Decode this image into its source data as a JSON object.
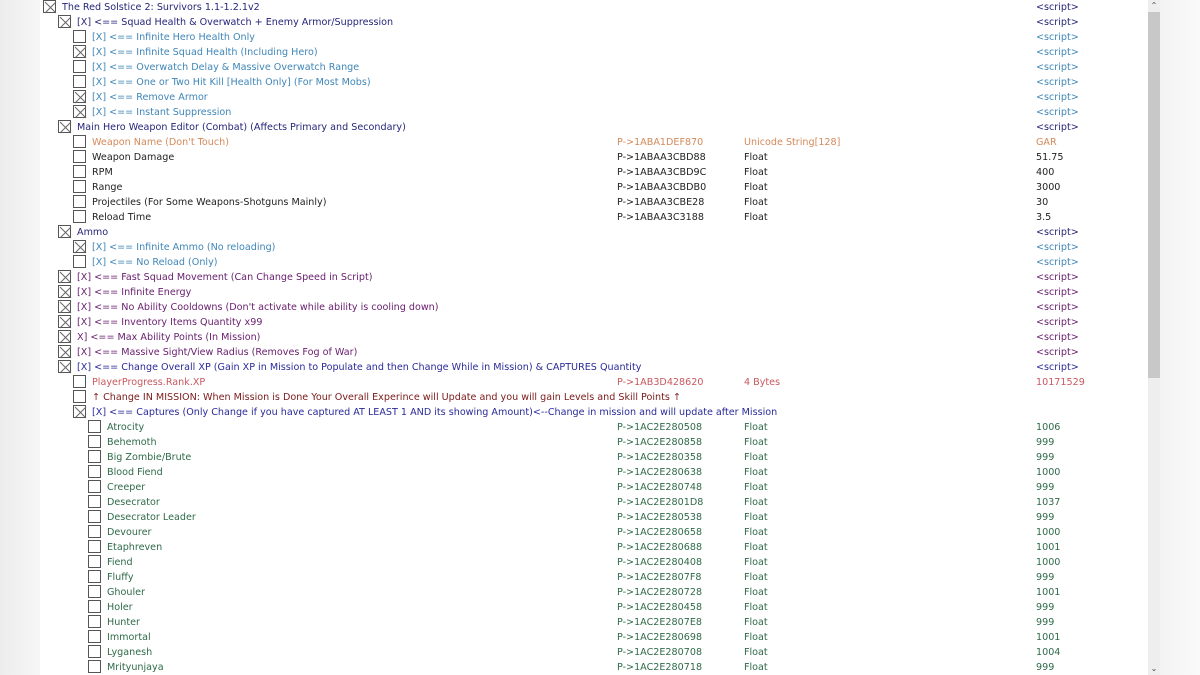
{
  "colors": {
    "header": "#25257a",
    "sub": "#3f86b8",
    "orange": "#d4895a",
    "black": "#222222",
    "purple": "#6a2070",
    "xp": "#c8585e",
    "note": "#7a1a1a",
    "captures": "#2a2a9a",
    "creature": "#2f6a48"
  },
  "rows": [
    {
      "level": 0,
      "checked": true,
      "color": "header",
      "desc": "The Red Solstice 2: Survivors 1.1-1.2.1v2",
      "value": "<script>"
    },
    {
      "level": 1,
      "checked": true,
      "color": "header",
      "desc": "[X] <== Squad Health & Overwatch + Enemy Armor/Suppression",
      "value": "<script>"
    },
    {
      "level": 2,
      "checked": false,
      "color": "sub",
      "desc": "[X] <== Infinite Hero Health Only",
      "value": "<script>"
    },
    {
      "level": 2,
      "checked": true,
      "color": "sub",
      "desc": "[X] <== Infinite Squad Health (Including Hero)",
      "value": "<script>"
    },
    {
      "level": 2,
      "checked": false,
      "color": "sub",
      "desc": "[X] <== Overwatch Delay & Massive Overwatch Range",
      "value": "<script>"
    },
    {
      "level": 2,
      "checked": false,
      "color": "sub",
      "desc": "[X] <== One or Two Hit Kill [Health Only] (For Most Mobs)",
      "value": "<script>"
    },
    {
      "level": 2,
      "checked": true,
      "color": "sub",
      "desc": "[X] <== Remove Armor",
      "value": "<script>"
    },
    {
      "level": 2,
      "checked": true,
      "color": "sub",
      "desc": "[X] <== Instant Suppression",
      "value": "<script>"
    },
    {
      "level": 1,
      "checked": true,
      "color": "header",
      "desc": "Main Hero Weapon Editor (Combat) (Affects Primary and Secondary)",
      "value": "<script>"
    },
    {
      "level": 2,
      "checked": false,
      "color": "orange",
      "desc": "Weapon Name (Don't Touch)",
      "addr": "P->1ABA1DEF870",
      "type": "Unicode String[128]",
      "value": "GAR"
    },
    {
      "level": 2,
      "checked": false,
      "color": "black",
      "desc": "Weapon Damage",
      "addr": "P->1ABAA3CBD88",
      "type": "Float",
      "value": "51.75"
    },
    {
      "level": 2,
      "checked": false,
      "color": "black",
      "desc": "RPM",
      "addr": "P->1ABAA3CBD9C",
      "type": "Float",
      "value": "400"
    },
    {
      "level": 2,
      "checked": false,
      "color": "black",
      "desc": "Range",
      "addr": "P->1ABAA3CBDB0",
      "type": "Float",
      "value": "3000"
    },
    {
      "level": 2,
      "checked": false,
      "color": "black",
      "desc": "Projectiles (For Some Weapons-Shotguns Mainly)",
      "addr": "P->1ABAA3CBE28",
      "type": "Float",
      "value": "30"
    },
    {
      "level": 2,
      "checked": false,
      "color": "black",
      "desc": "Reload Time",
      "addr": "P->1ABAA3C3188",
      "type": "Float",
      "value": "3.5"
    },
    {
      "level": 1,
      "checked": true,
      "color": "header",
      "desc": "Ammo",
      "value": "<script>"
    },
    {
      "level": 2,
      "checked": true,
      "color": "sub",
      "desc": "[X] <== Infinite Ammo (No reloading)",
      "value": "<script>"
    },
    {
      "level": 2,
      "checked": false,
      "color": "sub",
      "desc": "[X] <== No Reload (Only)",
      "value": "<script>"
    },
    {
      "level": 1,
      "checked": true,
      "color": "purple",
      "desc": "[X] <== Fast Squad Movement (Can Change Speed in Script)",
      "value": "<script>"
    },
    {
      "level": 1,
      "checked": true,
      "color": "purple",
      "desc": "[X] <== Infinite Energy",
      "value": "<script>"
    },
    {
      "level": 1,
      "checked": true,
      "color": "purple",
      "desc": "[X] <== No Ability Cooldowns (Don't activate while ability is cooling down)",
      "value": "<script>"
    },
    {
      "level": 1,
      "checked": true,
      "color": "purple",
      "desc": "[X] <== Inventory Items Quantity x99",
      "value": "<script>"
    },
    {
      "level": 1,
      "checked": true,
      "color": "purple",
      "desc": "X]  <== Max Ability Points (In Mission)",
      "value": "<script>"
    },
    {
      "level": 1,
      "checked": true,
      "color": "purple",
      "desc": "[X] <== Massive Sight/View Radius (Removes Fog of War)",
      "value": "<script>"
    },
    {
      "level": 1,
      "checked": true,
      "color": "captures",
      "desc": "[X] <== Change Overall XP (Gain XP in Mission to Populate and then Change While in Mission) & CAPTURES Quantity",
      "value": "<script>"
    },
    {
      "level": 2,
      "checked": false,
      "color": "xp",
      "desc": "PlayerProgress.Rank.XP",
      "addr": "P->1AB3D428620",
      "type": "4 Bytes",
      "value": "10171529"
    },
    {
      "level": 2,
      "checked": false,
      "color": "note",
      "desc": "↑ Change IN MISSION: When Mission is Done Your Overall Experince will Update and you will gain Levels and Skill Points ↑"
    },
    {
      "level": 2,
      "checked": true,
      "color": "captures",
      "desc": "[X] <== Captures (Only Change if you have captured AT LEAST 1 AND its showing Amount)<--Change in mission and will update after Mission"
    },
    {
      "level": 3,
      "checked": false,
      "color": "creature",
      "desc": "Atrocity",
      "addr": "P->1AC2E280508",
      "type": "Float",
      "value": "1006"
    },
    {
      "level": 3,
      "checked": false,
      "color": "creature",
      "desc": "Behemoth",
      "addr": "P->1AC2E280858",
      "type": "Float",
      "value": "999"
    },
    {
      "level": 3,
      "checked": false,
      "color": "creature",
      "desc": "Big Zombie/Brute",
      "addr": "P->1AC2E280358",
      "type": "Float",
      "value": "999"
    },
    {
      "level": 3,
      "checked": false,
      "color": "creature",
      "desc": "Blood Fiend",
      "addr": "P->1AC2E280638",
      "type": "Float",
      "value": "1000"
    },
    {
      "level": 3,
      "checked": false,
      "color": "creature",
      "desc": "Creeper",
      "addr": "P->1AC2E280748",
      "type": "Float",
      "value": "999"
    },
    {
      "level": 3,
      "checked": false,
      "color": "creature",
      "desc": "Desecrator",
      "addr": "P->1AC2E2801D8",
      "type": "Float",
      "value": "1037"
    },
    {
      "level": 3,
      "checked": false,
      "color": "creature",
      "desc": "Desecrator Leader",
      "addr": "P->1AC2E280538",
      "type": "Float",
      "value": "999"
    },
    {
      "level": 3,
      "checked": false,
      "color": "creature",
      "desc": "Devourer",
      "addr": "P->1AC2E280658",
      "type": "Float",
      "value": "1000"
    },
    {
      "level": 3,
      "checked": false,
      "color": "creature",
      "desc": "Etaphreven",
      "addr": "P->1AC2E280688",
      "type": "Float",
      "value": "1001"
    },
    {
      "level": 3,
      "checked": false,
      "color": "creature",
      "desc": "Fiend",
      "addr": "P->1AC2E280408",
      "type": "Float",
      "value": "1000"
    },
    {
      "level": 3,
      "checked": false,
      "color": "creature",
      "desc": "Fluffy",
      "addr": "P->1AC2E2807F8",
      "type": "Float",
      "value": "999"
    },
    {
      "level": 3,
      "checked": false,
      "color": "creature",
      "desc": "Ghouler",
      "addr": "P->1AC2E280728",
      "type": "Float",
      "value": "1001"
    },
    {
      "level": 3,
      "checked": false,
      "color": "creature",
      "desc": "Holer",
      "addr": "P->1AC2E280458",
      "type": "Float",
      "value": "999"
    },
    {
      "level": 3,
      "checked": false,
      "color": "creature",
      "desc": "Hunter",
      "addr": "P->1AC2E2807E8",
      "type": "Float",
      "value": "999"
    },
    {
      "level": 3,
      "checked": false,
      "color": "creature",
      "desc": "Immortal",
      "addr": "P->1AC2E280698",
      "type": "Float",
      "value": "1001"
    },
    {
      "level": 3,
      "checked": false,
      "color": "creature",
      "desc": "Lyganesh",
      "addr": "P->1AC2E280708",
      "type": "Float",
      "value": "1004"
    },
    {
      "level": 3,
      "checked": false,
      "color": "creature",
      "desc": "Mrityunjaya",
      "addr": "P->1AC2E280718",
      "type": "Float",
      "value": "999"
    }
  ],
  "scrollbar": {
    "position_fraction": 0.0,
    "visible_fraction": 0.54
  }
}
